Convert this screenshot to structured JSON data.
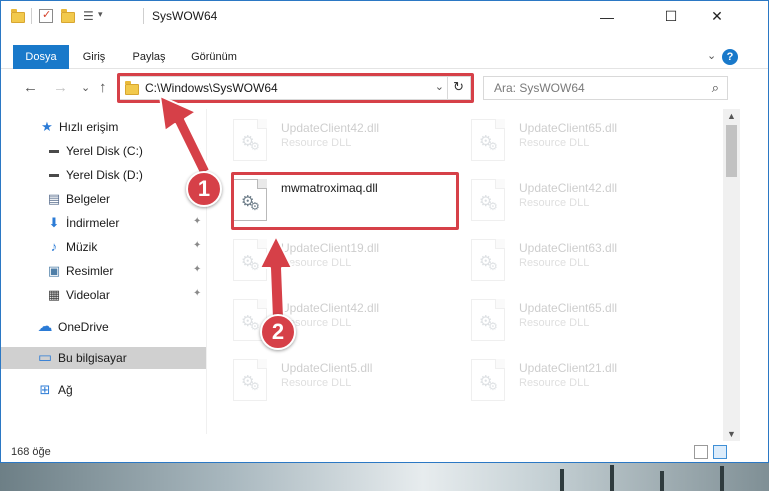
{
  "window": {
    "title": "SysWOW64",
    "minimize_glyph": "—",
    "maximize_glyph": "☐",
    "close_glyph": "✕"
  },
  "ribbon": {
    "tabs": [
      {
        "label": "Dosya",
        "active": true
      },
      {
        "label": "Giriş",
        "active": false
      },
      {
        "label": "Paylaş",
        "active": false
      },
      {
        "label": "Görünüm",
        "active": false
      }
    ],
    "expand_glyph": "⌄",
    "help_glyph": "?"
  },
  "nav": {
    "back_glyph": "←",
    "forward_glyph": "→",
    "recent_glyph": "⌄",
    "up_glyph": "↑",
    "address_value": "C:\\Windows\\SysWOW64",
    "address_dropdown_glyph": "⌄",
    "refresh_glyph": "↻",
    "search_placeholder": "Ara: SysWOW64",
    "search_glyph": "⌕"
  },
  "sidebar": {
    "items": [
      {
        "label": "Hızlı erişim",
        "icon": "star-icon",
        "glyph": "★",
        "color": "#2b7bd6",
        "pinned": false
      },
      {
        "label": "Yerel Disk (C:)",
        "icon": "drive-icon",
        "glyph": "▬",
        "color": "#4a4a4a",
        "pinned": true
      },
      {
        "label": "Yerel Disk (D:)",
        "icon": "drive-icon",
        "glyph": "▬",
        "color": "#4a4a4a",
        "pinned": false
      },
      {
        "label": "Belgeler",
        "icon": "documents-icon",
        "glyph": "▤",
        "color": "#5b6f8f",
        "pinned": true
      },
      {
        "label": "İndirmeler",
        "icon": "download-icon",
        "glyph": "⬇",
        "color": "#2b7bd6",
        "pinned": true
      },
      {
        "label": "Müzik",
        "icon": "music-icon",
        "glyph": "♪",
        "color": "#2b7bd6",
        "pinned": true
      },
      {
        "label": "Resimler",
        "icon": "pictures-icon",
        "glyph": "▣",
        "color": "#4f7fa8",
        "pinned": true
      },
      {
        "label": "Videolar",
        "icon": "videos-icon",
        "glyph": "▦",
        "color": "#3b3b3b",
        "pinned": true
      },
      {
        "label": "OneDrive",
        "icon": "cloud-icon",
        "glyph": "☁",
        "color": "#2b7bd6",
        "pinned": false
      },
      {
        "label": "Bu bilgisayar",
        "icon": "computer-icon",
        "glyph": "▭",
        "color": "#2b7bd6",
        "pinned": false,
        "selected": true
      },
      {
        "label": "Ağ",
        "icon": "network-icon",
        "glyph": "⊞",
        "color": "#2b7bd6",
        "pinned": false
      }
    ],
    "pin_glyph": "✦"
  },
  "files": [
    {
      "name": "UpdateClient42.dll",
      "type": "Resource DLL",
      "ghost": true
    },
    {
      "name": "UpdateClient65.dll",
      "type": "Resource DLL",
      "ghost": true
    },
    {
      "name": "mwmatroximaq.dll",
      "type": "",
      "ghost": false
    },
    {
      "name": "UpdateClient42.dll",
      "type": "Resource DLL",
      "ghost": true
    },
    {
      "name": "UpdateClient19.dll",
      "type": "Resource DLL",
      "ghost": true
    },
    {
      "name": "UpdateClient63.dll",
      "type": "Resource DLL",
      "ghost": true
    },
    {
      "name": "UpdateClient42.dll",
      "type": "Resource DLL",
      "ghost": true
    },
    {
      "name": "UpdateClient65.dll",
      "type": "Resource DLL",
      "ghost": true
    },
    {
      "name": "UpdateClient5.dll",
      "type": "Resource DLL",
      "ghost": true
    },
    {
      "name": "UpdateClient21.dll",
      "type": "Resource DLL",
      "ghost": true
    }
  ],
  "gear_glyph": "⚙",
  "status": {
    "item_count": "168 öğe"
  },
  "annotations": {
    "badge1": "1",
    "badge2": "2",
    "color": "#d64048"
  }
}
